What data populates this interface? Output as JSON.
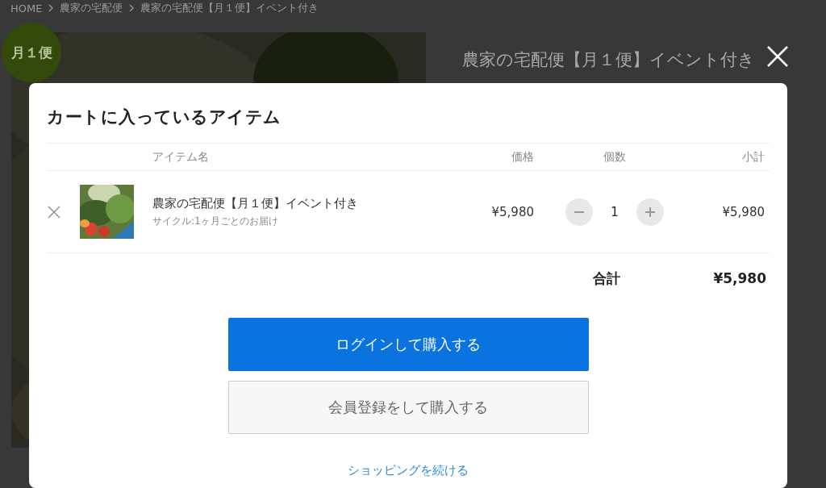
{
  "breadcrumb": [
    "HOME",
    "農家の宅配便",
    "農家の宅配便【月１便】イベント付き"
  ],
  "product": {
    "badge": "月１便",
    "title": "農家の宅配便【月１便】イベント付き"
  },
  "cart": {
    "title": "カートに入っているアイテム",
    "columns": [
      "アイテム名",
      "価格",
      "個数",
      "小計"
    ],
    "items": [
      {
        "name": "農家の宅配便【月１便】イベント付き",
        "cycle": "サイクル:1ヶ月ごとのお届け",
        "price": "¥5,980",
        "quantity": "1",
        "subtotal": "¥5,980"
      }
    ],
    "total_label": "合計",
    "total": "¥5,980",
    "buttons": [
      {
        "label": "ログインして購入する",
        "kind": "primary"
      },
      {
        "label": "会員登録をして購入する",
        "kind": "secondary"
      }
    ],
    "continue_link": "ショッピングを続ける"
  }
}
